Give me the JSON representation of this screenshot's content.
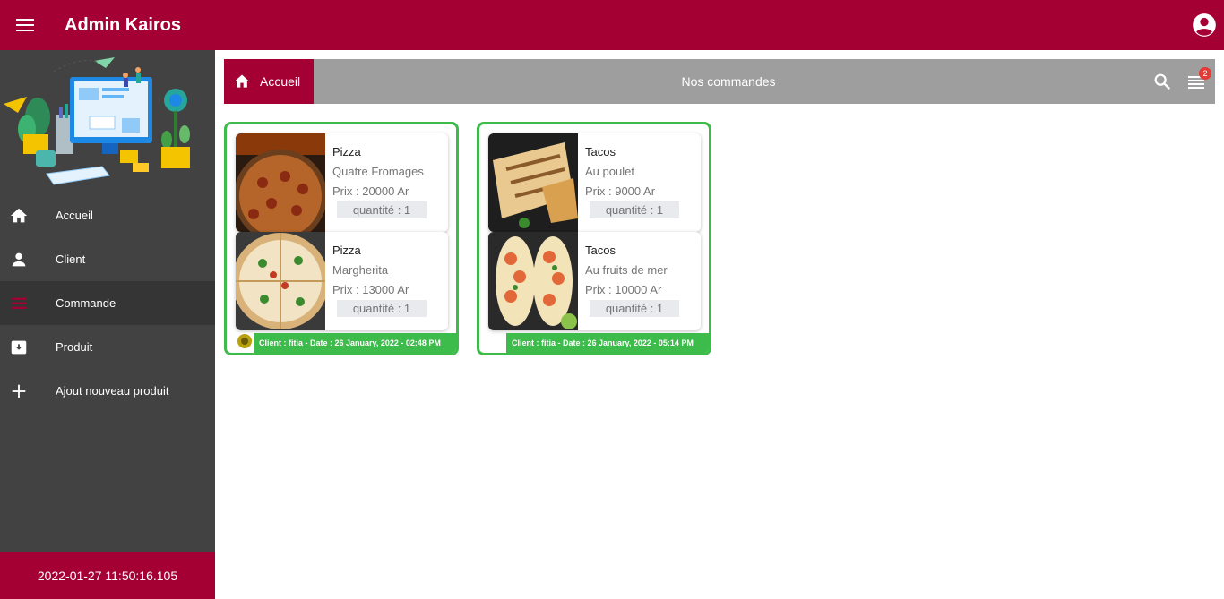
{
  "appbar": {
    "title": "Admin Kairos"
  },
  "sidebar": {
    "items": [
      {
        "label": "Accueil",
        "icon": "home-icon"
      },
      {
        "label": "Client",
        "icon": "person-icon"
      },
      {
        "label": "Commande",
        "icon": "list-icon"
      },
      {
        "label": "Produit",
        "icon": "archive-icon"
      },
      {
        "label": "Ajout nouveau produit",
        "icon": "plus-icon"
      }
    ],
    "active_item": "Commande",
    "clock": "2022-01-27 11:50:16.105"
  },
  "toolbar": {
    "home_label": "Accueil",
    "title": "Nos commandes",
    "badge_count": "2"
  },
  "orders": [
    {
      "items": [
        {
          "name": "Pizza",
          "variant": "Quatre Fromages",
          "price": "Prix : 20000 Ar",
          "quantity": "quantité : 1"
        },
        {
          "name": "Pizza",
          "variant": "Margherita",
          "price": "Prix : 13000 Ar",
          "quantity": "quantité : 1"
        }
      ],
      "footer": "Client : fitia  - Date : 26 January, 2022 - 02:48 PM"
    },
    {
      "items": [
        {
          "name": "Tacos",
          "variant": "Au poulet",
          "price": "Prix : 9000 Ar",
          "quantity": "quantité : 1"
        },
        {
          "name": "Tacos",
          "variant": "Au fruits de mer",
          "price": "Prix : 10000 Ar",
          "quantity": "quantité : 1"
        }
      ],
      "footer": "Client : fitia  - Date : 26 January, 2022 - 05:14 PM"
    }
  ],
  "colors": {
    "primary": "#a50034",
    "sidebar": "#424242",
    "toolbar": "#9e9e9e",
    "order_border": "#3dbb4b",
    "badge": "#e53935"
  }
}
